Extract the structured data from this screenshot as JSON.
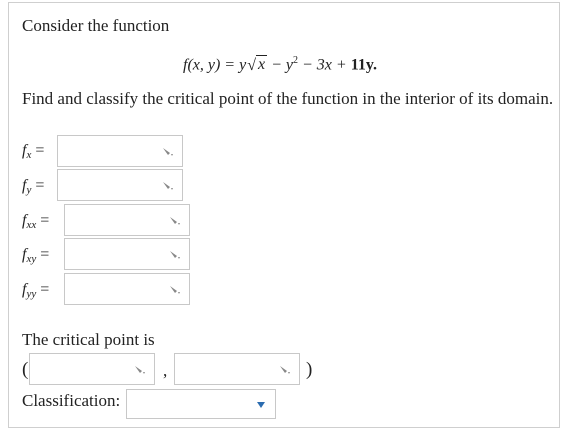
{
  "intro": "Consider the function",
  "formula": {
    "lhs": "f(x, y) = y",
    "sqrt_arg": "x",
    "rhs_mid": " − y",
    "sup": "2",
    "rhs_end": " − 3x + ",
    "bold_tail": "11y."
  },
  "instruction": "Find and classify the critical point of the function in the interior of its domain.",
  "partials": [
    {
      "f": "f",
      "sub": "x",
      "eq": "="
    },
    {
      "f": "f",
      "sub": "y",
      "eq": "="
    },
    {
      "f": "f",
      "sub": "xx",
      "eq": "="
    },
    {
      "f": "f",
      "sub": "xy",
      "eq": "="
    },
    {
      "f": "f",
      "sub": "yy",
      "eq": "="
    }
  ],
  "critical_point": {
    "label": "The critical point is",
    "open": "(",
    "comma": ",",
    "close": ")"
  },
  "classification": {
    "label": "Classification:",
    "selected": ""
  },
  "colors": {
    "accent": "#2b6cb0",
    "border": "#c8c8c8"
  }
}
